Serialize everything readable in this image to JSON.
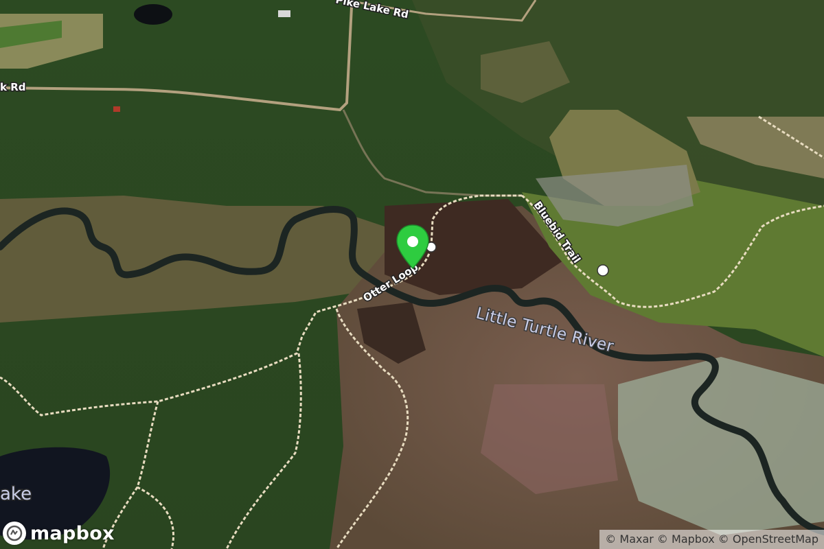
{
  "map": {
    "labels": {
      "road_top": "Pike Lake Rd",
      "road_left": "k Rd",
      "trail_bluebird": "Bluebid Trail",
      "trail_otter": "Otter Loop",
      "river": "Little Turtle River",
      "lake_partial": "ake"
    },
    "colors": {
      "forest": "#2f4a22",
      "wetland": "#6b5a45",
      "marsh_dark": "#3b2a22",
      "grass": "#5c7a35",
      "river_water": "#1b2424",
      "lake_water": "#111520",
      "trail": "#e8dcc0",
      "marker": "#2ecc40"
    }
  },
  "logo": {
    "text": "mapbox",
    "icon": "mapbox-logo-icon"
  },
  "attribution": {
    "text": "© Maxar © Mapbox © OpenStreetMap"
  },
  "marker": {
    "icon": "map-pin-icon"
  }
}
